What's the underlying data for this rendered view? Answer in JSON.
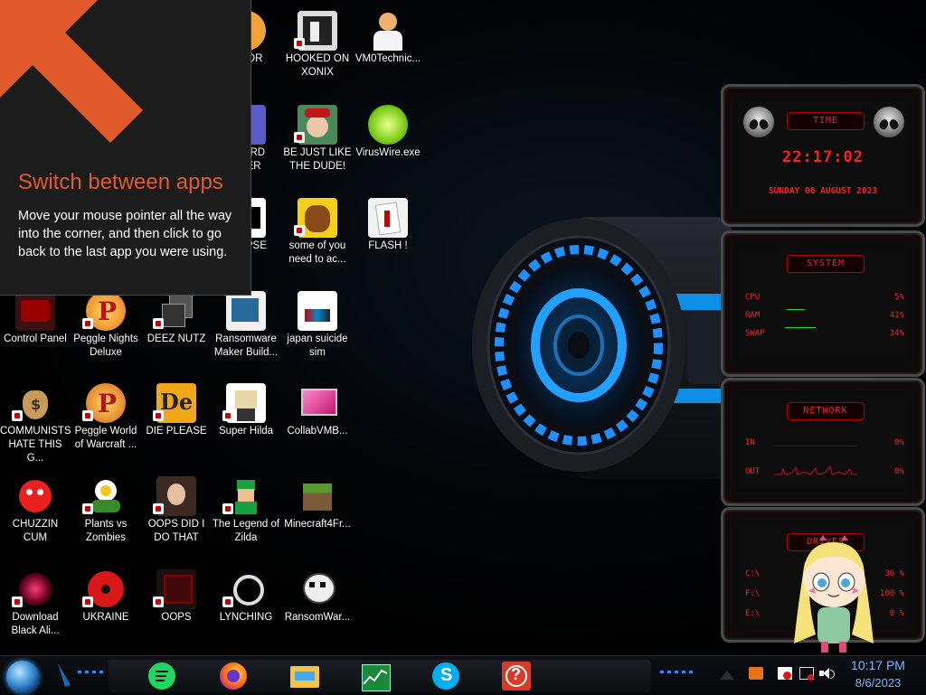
{
  "hint": {
    "title": "Switch between apps",
    "body": "Move your mouse pointer all the way into the corner, and then click to go back to the last app you were using."
  },
  "desktop_icons": [
    {
      "label": "...ITOR"
    },
    {
      "label": "HOOKED ON XONIX"
    },
    {
      "label": "VM0Technic..."
    },
    {
      "label": "...CARD ...KER"
    },
    {
      "label": "BE JUST LIKE THE DUDE!"
    },
    {
      "label": "VirusWire.exe"
    },
    {
      "label": "...LYPSE"
    },
    {
      "label": "some of you need to ac..."
    },
    {
      "label": "FLASH !"
    },
    {
      "label": "Control Panel"
    },
    {
      "label": "Peggle Nights Deluxe"
    },
    {
      "label": "DEEZ NUTZ"
    },
    {
      "label": "Ransomware Maker Build..."
    },
    {
      "label": "japan suicide sim"
    },
    {
      "label": "COMMUNISTS HATE THIS G..."
    },
    {
      "label": "Peggle World of Warcraft ..."
    },
    {
      "label": "DIE PLEASE"
    },
    {
      "label": "Super Hilda"
    },
    {
      "label": "CollabVMB..."
    },
    {
      "label": "CHUZZIN CUM"
    },
    {
      "label": "Plants vs Zombies"
    },
    {
      "label": "OOPS DID I DO THAT"
    },
    {
      "label": "The Legend of Zilda"
    },
    {
      "label": "Minecraft4Fr..."
    },
    {
      "label": "Download Black Ali..."
    },
    {
      "label": "UKRAINE"
    },
    {
      "label": "OOPS"
    },
    {
      "label": "LYNCHING"
    },
    {
      "label": "RansomWar..."
    }
  ],
  "widget": {
    "time": {
      "header": "TIME",
      "clock": "22:17:02",
      "date": "SUNDAY 06 AUGUST 2023"
    },
    "system": {
      "header": "SYSTEM",
      "rows": [
        {
          "label": "CPU",
          "value": "5%"
        },
        {
          "label": "RAM",
          "value": "41%"
        },
        {
          "label": "SWAP",
          "value": "34%"
        }
      ]
    },
    "network": {
      "header": "NETWORK",
      "rows": [
        {
          "label": "IN",
          "value": "0%"
        },
        {
          "label": "OUT",
          "value": "0%"
        }
      ]
    },
    "drives": {
      "header": "DRIVES",
      "rows": [
        {
          "label": "C:\\",
          "value": "36 %"
        },
        {
          "label": "F:\\",
          "value": "100 %"
        },
        {
          "label": "E:\\",
          "value": "0 %"
        }
      ]
    }
  },
  "taskbar": {
    "apps": [
      "spotify-icon",
      "firefox-icon",
      "file-explorer-icon",
      "task-manager-icon",
      "skype-icon",
      "help-icon"
    ],
    "clock_time": "10:17 PM",
    "clock_date": "8/6/2023"
  },
  "colors": {
    "hint_accent": "#e05a2b",
    "widget_red": "#ff1f1f",
    "clock_blue": "#7ab8ff",
    "cylinder_blue": "#1e90ff"
  }
}
